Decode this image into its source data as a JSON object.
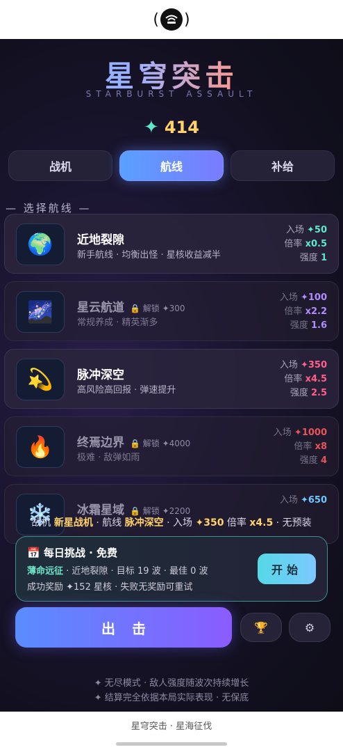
{
  "game": {
    "title": "星穹突击",
    "subtitle": "STARBURST ASSAULT",
    "currency_icon": "✦",
    "currency": "414"
  },
  "tabs": [
    {
      "label": "战机"
    },
    {
      "label": "航线"
    },
    {
      "label": "补给"
    }
  ],
  "active_tab": "航线",
  "section_title": "— 选择航线 —",
  "routes": [
    {
      "name": "近地裂隙",
      "icon": "earth-globe-icon",
      "emoji": "🌍",
      "locked": false,
      "desc": "新手航线 · 均衡出怪 · 星核收益减半",
      "entry_label": "入场",
      "entry_value": "✦50",
      "rate_label": "倍率",
      "rate_value": "x0.5",
      "power_label": "强度",
      "power_value": "1",
      "color": "#5ee8c9"
    },
    {
      "name": "星云航道",
      "icon": "milky-way-icon",
      "emoji": "🌌",
      "locked": true,
      "lock_text": "解锁 ✦300",
      "desc": "常规养成 · 精英渐多",
      "entry_label": "入场",
      "entry_value": "✦100",
      "rate_label": "倍率",
      "rate_value": "x2.2",
      "power_label": "强度",
      "power_value": "1.6",
      "color": "#b38cff"
    },
    {
      "name": "脉冲深空",
      "icon": "dizzy-star-icon",
      "emoji": "💫",
      "locked": false,
      "desc": "高风险高回报 · 弹速提升",
      "entry_label": "入场",
      "entry_value": "✦350",
      "rate_label": "倍率",
      "rate_value": "x4.5",
      "power_label": "强度",
      "power_value": "2.5",
      "color": "#ff5f8a"
    },
    {
      "name": "终焉边界",
      "icon": "fire-icon",
      "emoji": "🔥",
      "locked": true,
      "lock_text": "解锁 ✦4000",
      "desc": "极难 · 敌弹如雨",
      "entry_label": "入场",
      "entry_value": "✦1000",
      "rate_label": "倍率",
      "rate_value": "x8",
      "power_label": "强度",
      "power_value": "4",
      "color": "#e8545a"
    },
    {
      "name": "冰霜星域",
      "icon": "snowflake-icon",
      "emoji": "❄️",
      "locked": true,
      "lock_text": "解锁 ✦2200",
      "desc": "",
      "entry_label": "入场",
      "entry_value": "✦650",
      "rate_label": "",
      "rate_value": "",
      "power_label": "",
      "power_value": "",
      "color": "#6ec8ff"
    }
  ],
  "summary": {
    "p1": "战机 ",
    "ship": "新星战机",
    "p2": " · 航线 ",
    "route": "脉冲深空",
    "p3": " · 入场 ",
    "entry": "✦350",
    "p4": " 倍率 ",
    "rate": "x4.5",
    "p5": " · 无预装"
  },
  "daily": {
    "title": "📅 每日挑战 · 免费",
    "mode": "薄命远征",
    "line1": " · 近地裂隙 · 目标 19 波 · 最佳 0 波",
    "line2": "成功奖励 ✦152 星核 · 失败无奖励可重试",
    "start_label": "开始"
  },
  "launch_label": "出击",
  "side_buttons": {
    "trophy": "🏆",
    "settings": "⚙"
  },
  "footer": [
    "✦ 无尽模式 · 敌人强度随波次持续增长",
    "✦ 结算完全依据本局实际表现 · 无保底"
  ],
  "bottom_bar": {
    "text": "星穹突击 · 星海征伐"
  }
}
